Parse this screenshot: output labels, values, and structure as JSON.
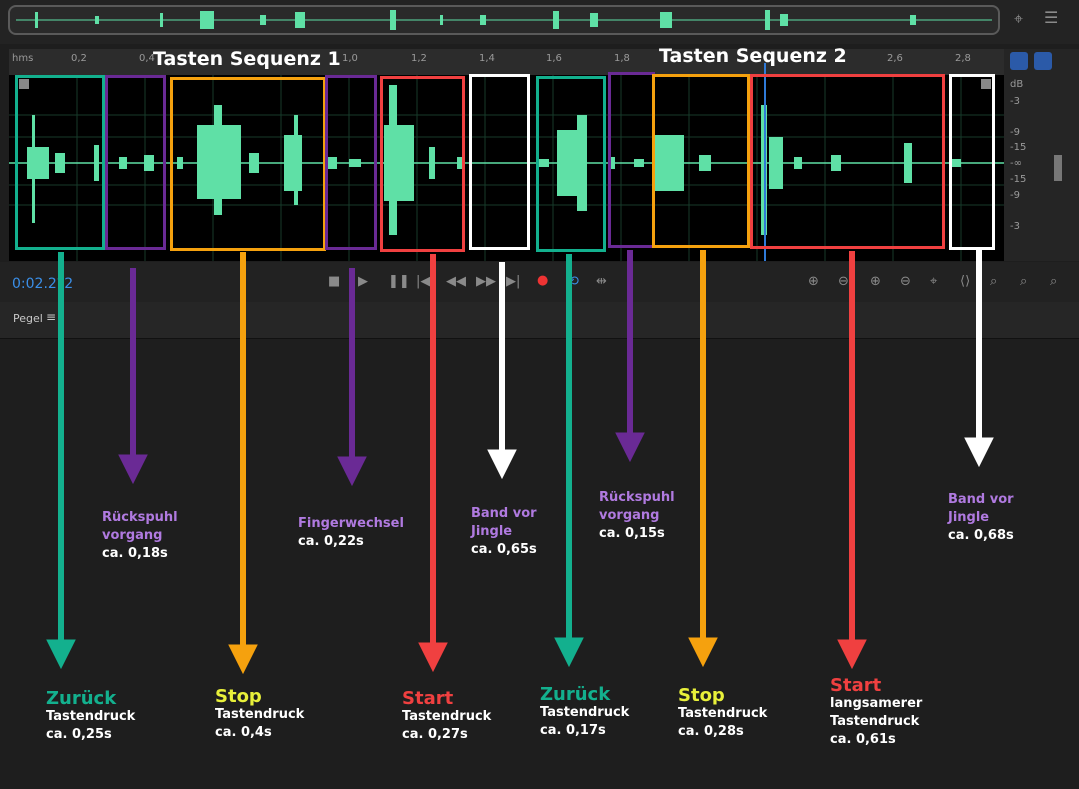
{
  "editor": {
    "ruler_unit": "hms",
    "ruler_ticks": [
      "0,2",
      "0,4",
      "1,0",
      "1,2",
      "1,4",
      "1,6",
      "1,8",
      "2,6",
      "2,8"
    ],
    "db_unit": "dB",
    "db_labels": [
      "-3",
      "-9",
      "-15",
      "-∞",
      "-15",
      "-9",
      "-3"
    ],
    "time_display": "0:02.2?2",
    "panel_label": "Pegel"
  },
  "sequences": {
    "seq1_title": "Tasten Sequenz 1",
    "seq2_title": "Tasten Sequenz 2"
  },
  "colors": {
    "teal": "#13b08e",
    "purple": "#6a2a95",
    "orange": "#f5a10e",
    "red": "#f04040",
    "white": "#ffffff",
    "wave": "#5fe0a6"
  },
  "annotations": {
    "zurueck1": {
      "title": "Zurück",
      "line2": "Tastendruck",
      "line3": "ca. 0,25s"
    },
    "rueck1": {
      "line1": "Rückspuhl",
      "line2": "vorgang",
      "line3": "ca. 0,18s"
    },
    "stop1": {
      "title": "Stop",
      "line2": "Tastendruck",
      "line3": "ca. 0,4s"
    },
    "finger": {
      "line1": "Fingerwechsel",
      "line2": "ca. 0,22s"
    },
    "start1": {
      "title": "Start",
      "line2": "Tastendruck",
      "line3": "ca. 0,27s"
    },
    "band1": {
      "line1": "Band vor",
      "line2": "Jingle",
      "line3": "ca. 0,65s"
    },
    "zurueck2": {
      "title": "Zurück",
      "line2": "Tastendruck",
      "line3": "ca. 0,17s"
    },
    "rueck2": {
      "line1": "Rückspuhl",
      "line2": "vorgang",
      "line3": "ca. 0,15s"
    },
    "stop2": {
      "title": "Stop",
      "line2": "Tastendruck",
      "line3": "ca. 0,28s"
    },
    "start2": {
      "title": "Start",
      "line2": "langsamerer",
      "line3": "Tastendruck",
      "line4": "ca. 0,61s"
    },
    "band2": {
      "line1": "Band vor",
      "line2": "Jingle",
      "line3": "ca. 0,68s"
    }
  }
}
